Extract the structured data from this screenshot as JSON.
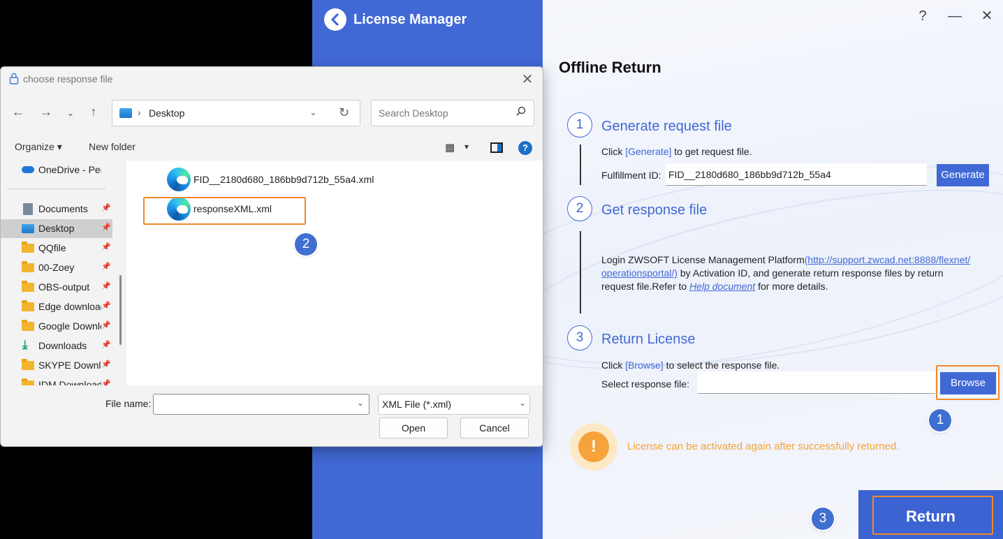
{
  "app": {
    "title": "License Manager",
    "window_controls": {
      "help": "?",
      "minimize": "—",
      "close": "✕"
    }
  },
  "offline_return": {
    "title": "Offline Return",
    "step1": {
      "number": "1",
      "title": "Generate request file",
      "instruction_prefix": "Click ",
      "instruction_link": "[Generate]",
      "instruction_suffix": " to get request file.",
      "fulfillment_label": "Fulfillment ID:",
      "fulfillment_value": "FID__2180d680_186bb9d712b_55a4",
      "generate_button": "Generate"
    },
    "step2": {
      "number": "2",
      "title": "Get response file",
      "text_prefix": "Login ZWSOFT License Management Platform",
      "url_line1": "(http://support.zwcad.net:8888/flexnet/",
      "url_line2": "operationsportal/)",
      "text_mid": " by Activation ID, and generate return response files by return",
      "text_line3_prefix": "request file.Refer to ",
      "help_link": "Help document",
      "text_line3_suffix": " for more details."
    },
    "step3": {
      "number": "3",
      "title": "Return License",
      "instruction_prefix": "Click ",
      "instruction_link": "[Browse]",
      "instruction_suffix": " to select the response file.",
      "select_label": "Select response file:",
      "select_value": "",
      "browse_button": "Browse"
    },
    "warning": {
      "icon": "!",
      "text": "License can be activated again after successfully returned."
    },
    "return_button": "Return"
  },
  "annotations": {
    "badge1": "1",
    "badge2": "2",
    "badge3": "3"
  },
  "dialog": {
    "title": "choose response file",
    "close": "✕",
    "address": {
      "separator": "›",
      "path": "Desktop"
    },
    "search_placeholder": "Search Desktop",
    "toolbar": {
      "organize": "Organize ▾",
      "new_folder": "New folder",
      "view": "▦",
      "help": "?"
    },
    "nav_items": [
      {
        "label": "OneDrive - Personal",
        "icon": "cloud",
        "pinned": false
      },
      {
        "label": "Documents",
        "icon": "doc",
        "pinned": true
      },
      {
        "label": "Desktop",
        "icon": "desktop",
        "pinned": true,
        "selected": true
      },
      {
        "label": "QQfile",
        "icon": "folder",
        "pinned": true
      },
      {
        "label": "00-Zoey",
        "icon": "folder",
        "pinned": true
      },
      {
        "label": "OBS-output",
        "icon": "folder",
        "pinned": true
      },
      {
        "label": "Edge downloads",
        "icon": "folder",
        "pinned": true
      },
      {
        "label": "Google Downloads",
        "icon": "folder",
        "pinned": true
      },
      {
        "label": "Downloads",
        "icon": "download",
        "pinned": true
      },
      {
        "label": "SKYPE Downloads",
        "icon": "folder",
        "pinned": true
      },
      {
        "label": "IDM Downloads",
        "icon": "folder",
        "pinned": true
      }
    ],
    "files": [
      {
        "name": "FID__2180d680_186bb9d712b_55a4.xml"
      },
      {
        "name": "responseXML.xml"
      }
    ],
    "filename_label": "File name:",
    "filename_value": "",
    "filetype": "XML File (*.xml)",
    "open_button": "Open",
    "cancel_button": "Cancel"
  },
  "colors": {
    "accent": "#4169d6",
    "callout": "#f08a2c",
    "warning": "#f5a33a"
  }
}
